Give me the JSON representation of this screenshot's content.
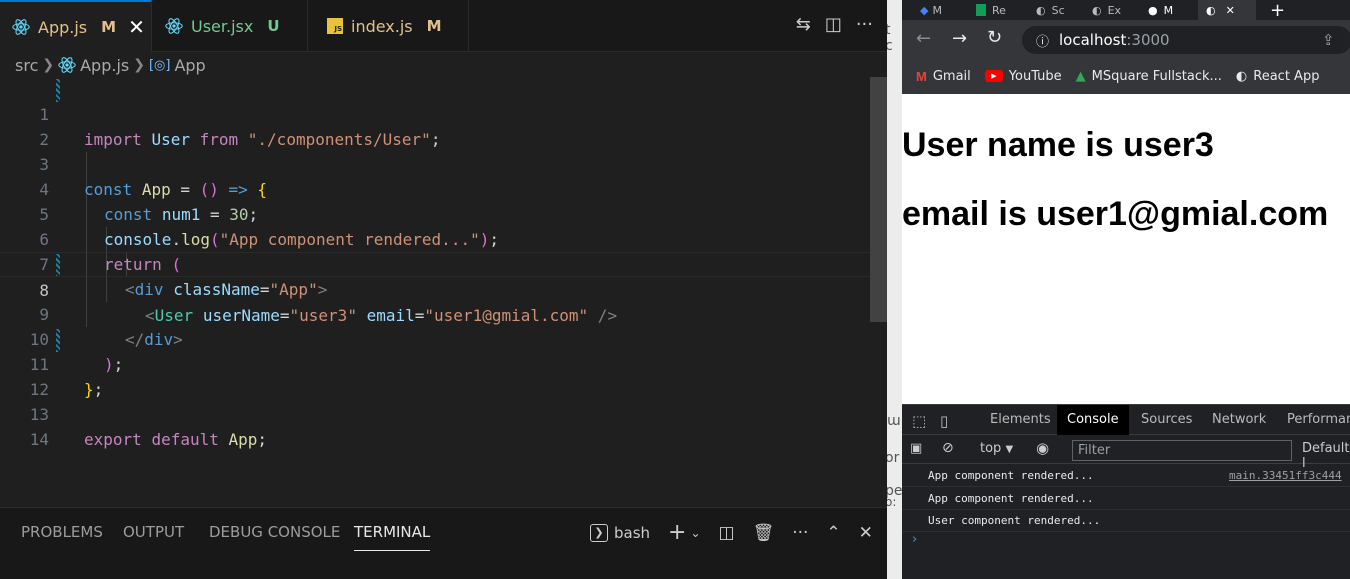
{
  "editor_tabs": [
    {
      "label": "App.js",
      "status": "M",
      "active": true
    },
    {
      "label": "User.jsx",
      "status": "U",
      "active": false
    },
    {
      "label": "index.js",
      "status": "M",
      "active": false
    }
  ],
  "breadcrumb": {
    "folder": "src",
    "file": "App.js",
    "symbol": "App"
  },
  "code_lines": [
    {
      "n": "1"
    },
    {
      "n": "2"
    },
    {
      "n": "3"
    },
    {
      "n": "4"
    },
    {
      "n": "5"
    },
    {
      "n": "6"
    },
    {
      "n": "7"
    },
    {
      "n": "8"
    },
    {
      "n": "9"
    },
    {
      "n": "10"
    },
    {
      "n": "11"
    },
    {
      "n": "12"
    },
    {
      "n": "13"
    },
    {
      "n": "14"
    }
  ],
  "code": {
    "l1": {
      "import": "import",
      "name": "User",
      "from": "from",
      "path": "\"./components/User\"",
      "semi": ";"
    },
    "l3": {
      "const": "const",
      "name": "App",
      "eq": " = ",
      "paren": "()",
      "arrow": " => ",
      "brace": "{"
    },
    "l4": {
      "const": "const",
      "name": "num1",
      "eq": " = ",
      "value": "30",
      "semi": ";"
    },
    "l5": {
      "obj": "console",
      "dot": ".",
      "fn": "log",
      "open": "(",
      "str": "\"App component rendered...\"",
      "close": ")",
      "semi": ";"
    },
    "l6": {
      "return": "return",
      "paren": "("
    },
    "l7": {
      "lt": "<",
      "tag": "div",
      "attr": "className",
      "eq": "=",
      "val": "\"App\"",
      "gt": ">"
    },
    "l8": {
      "lt": "<",
      "tag": "User",
      "attr1": "userName",
      "eq1": "=",
      "val1": "\"user3\"",
      "attr2": "email",
      "eq2": "=",
      "val2": "\"user1@gmial.com\"",
      "end": " />"
    },
    "l9": {
      "lt": "</",
      "tag": "div",
      "gt": ">"
    },
    "l10": {
      "paren": ")",
      "semi": ";"
    },
    "l11": {
      "brace": "}",
      "semi": ";"
    },
    "l13": {
      "export": "export",
      "default": "default",
      "name": "App",
      "semi": ";"
    }
  },
  "panel_tabs": [
    "PROBLEMS",
    "OUTPUT",
    "DEBUG CONSOLE",
    "TERMINAL"
  ],
  "terminal_shell": "bash",
  "browser": {
    "tabs": [
      "M",
      "Re",
      "Sc",
      "Ex",
      "M"
    ],
    "url_host": "localhost",
    "url_port": ":3000",
    "bookmarks": [
      "Gmail",
      "YouTube",
      "MSquare Fullstack...",
      "React App"
    ]
  },
  "page": {
    "line1": "User name is user3",
    "line2": "email is user1@gmial.com"
  },
  "devtools": {
    "tabs": [
      "Elements",
      "Console",
      "Sources",
      "Network",
      "Performan"
    ],
    "context": "top",
    "filter_placeholder": "Filter",
    "levels": "Default l",
    "messages": [
      {
        "text": "App component rendered...",
        "source": "main.33451ff3c444"
      },
      {
        "text": "App component rendered...",
        "source": ""
      },
      {
        "text": "User component rendered...",
        "source": ""
      }
    ]
  },
  "gap_fragments": [
    "t c",
    "ɯ",
    "or",
    "pe",
    "o:"
  ],
  "colors": {
    "accent": "#0078d4",
    "modified": "#e2c08d",
    "untracked": "#73c991"
  }
}
